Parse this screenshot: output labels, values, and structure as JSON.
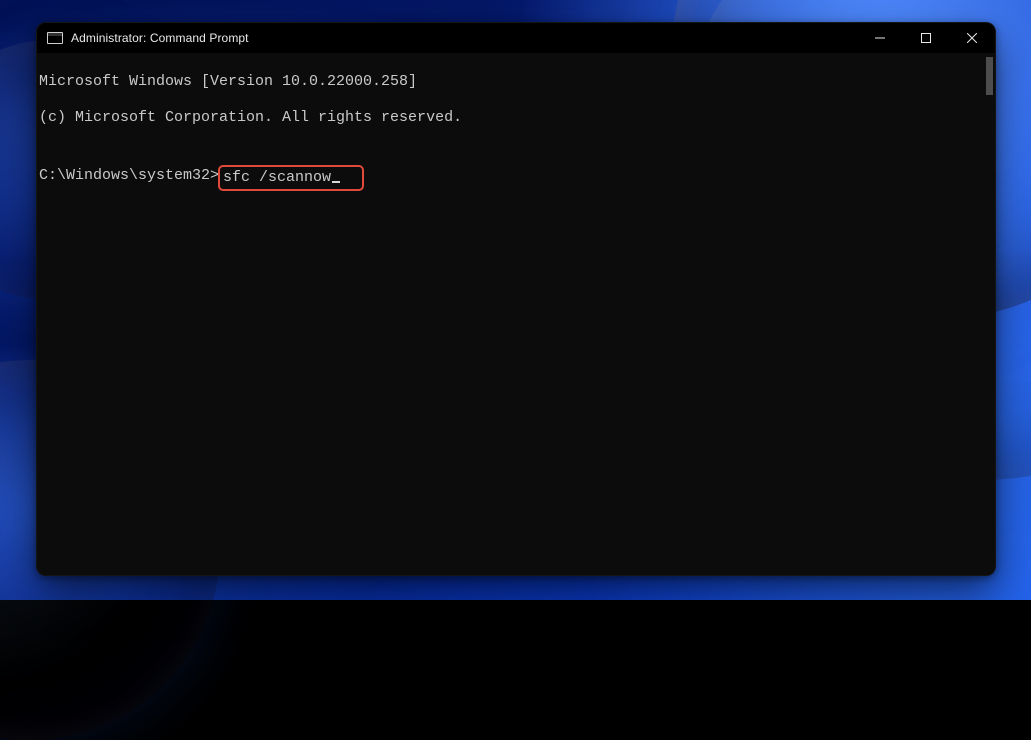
{
  "window": {
    "title": "Administrator: Command Prompt"
  },
  "terminal": {
    "lines": [
      "Microsoft Windows [Version 10.0.22000.258]",
      "(c) Microsoft Corporation. All rights reserved.",
      ""
    ],
    "prompt": "C:\\Windows\\system32>",
    "command": "sfc /scannow"
  },
  "annotation": {
    "highlight_color": "#e04a3a"
  }
}
